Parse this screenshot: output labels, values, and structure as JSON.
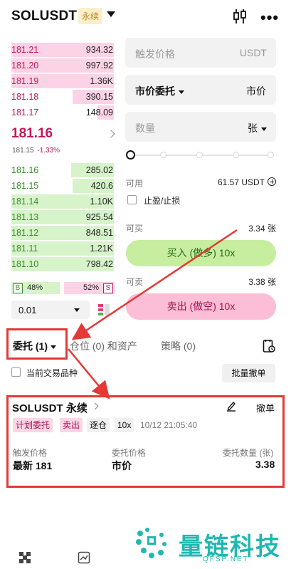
{
  "header": {
    "symbol": "SOLUSDT",
    "badge": "永续"
  },
  "orderbook": {
    "asks": [
      {
        "price": "181.21",
        "qty": "934.32",
        "depth": 1.0
      },
      {
        "price": "181.20",
        "qty": "997.92",
        "depth": 1.0
      },
      {
        "price": "181.19",
        "qty": "1.36K",
        "depth": 1.0
      },
      {
        "price": "181.18",
        "qty": "390.15",
        "depth": 0.4
      },
      {
        "price": "181.17",
        "qty": "148.09",
        "depth": 0.16
      }
    ],
    "last_price": "181.16",
    "mark_price": "181.15",
    "change_pct": "-1.33%",
    "bids": [
      {
        "price": "181.16",
        "qty": "285.02",
        "depth": 0.42
      },
      {
        "price": "181.15",
        "qty": "420.6",
        "depth": 0.4
      },
      {
        "price": "181.14",
        "qty": "1.10K",
        "depth": 1.0
      },
      {
        "price": "181.13",
        "qty": "925.54",
        "depth": 1.0
      },
      {
        "price": "181.12",
        "qty": "848.51",
        "depth": 1.0
      },
      {
        "price": "181.11",
        "qty": "1.21K",
        "depth": 1.0
      },
      {
        "price": "181.10",
        "qty": "798.42",
        "depth": 1.0
      }
    ],
    "ratio": {
      "buy_tag": "B",
      "buy_pct": "48%",
      "sell_pct": "52%",
      "sell_tag": "S"
    },
    "precision": "0.01"
  },
  "form": {
    "trigger_placeholder": "触发价格",
    "trigger_unit": "USDT",
    "order_type": "市价委托",
    "order_type_value": "市价",
    "qty_placeholder": "数量",
    "qty_unit": "张",
    "available_label": "可用",
    "available_value": "61.57 USDT",
    "tpsl_label": "止盈/止损",
    "can_buy_label": "可买",
    "can_buy_value": "3.34 张",
    "buy_button": "买入 (做多) 10x",
    "can_sell_label": "可卖",
    "can_sell_value": "3.38 张",
    "sell_button": "卖出 (做空) 10x"
  },
  "tabs": {
    "orders": "委托 (1)",
    "positions": "仓位 (0) 和资产",
    "strategy": "策略 (0)"
  },
  "filter": {
    "current_symbol": "当前交易品种",
    "cancel_all": "批量撤单"
  },
  "order_card": {
    "symbol": "SOLUSDT 永续",
    "cancel": "撤单",
    "tags": {
      "plan": "计划委托",
      "side": "卖出",
      "margin": "逐仓",
      "leverage": "10x"
    },
    "time": "10/12 21:05:40",
    "trigger_label": "触发价格",
    "trigger_value": "最新 181",
    "price_label": "委托价格",
    "price_value": "市价",
    "qty_label": "委托数量 (张)",
    "qty_value": "3.38"
  },
  "watermark": {
    "name": "量链科技",
    "site": "QFSP.NET"
  },
  "colors": {
    "ask": "#c2185b",
    "bid": "#3a8d2c",
    "highlight": "#e53935",
    "brand": "#1fb8b0"
  }
}
